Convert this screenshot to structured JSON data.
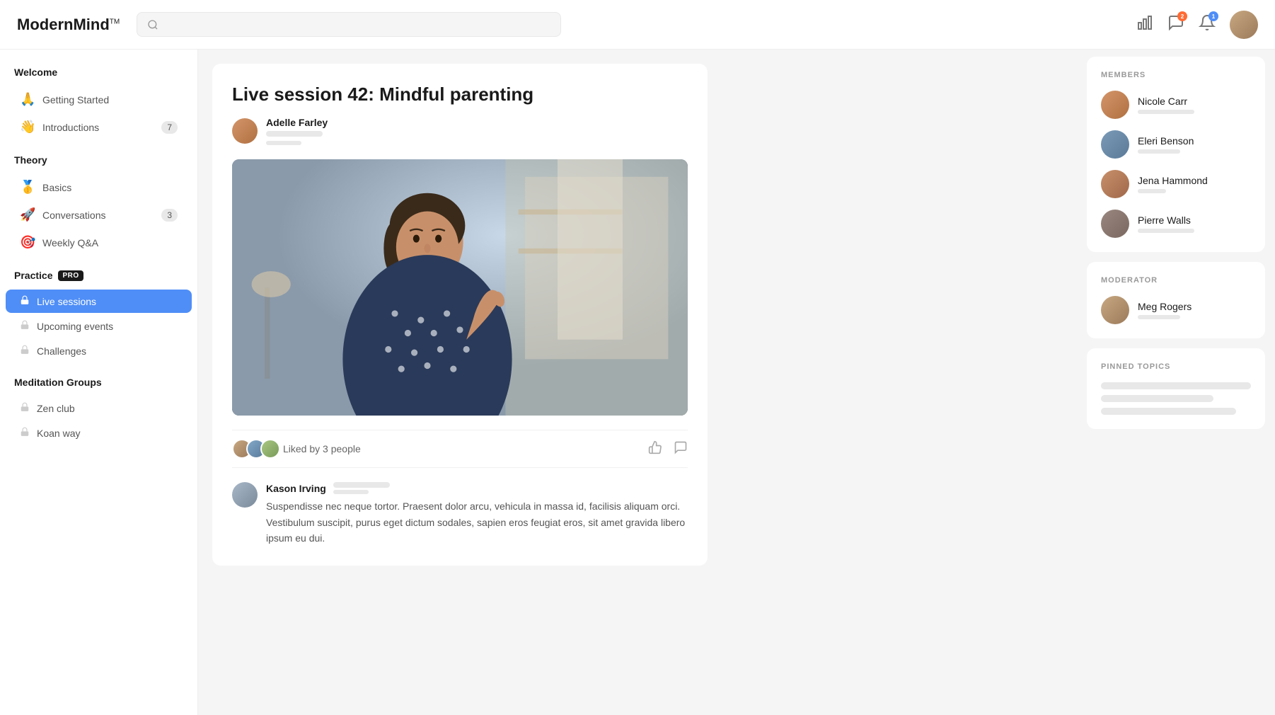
{
  "header": {
    "logo": "ModernMind",
    "logo_tm": "TM",
    "search_placeholder": ""
  },
  "sidebar": {
    "sections": [
      {
        "label": "Welcome",
        "items": [
          {
            "id": "getting-started",
            "icon": "🙏",
            "label": "Getting Started",
            "badge": null,
            "locked": false,
            "active": false
          },
          {
            "id": "introductions",
            "icon": "👋",
            "label": "Introductions",
            "badge": "7",
            "locked": false,
            "active": false
          }
        ]
      },
      {
        "label": "Theory",
        "items": [
          {
            "id": "basics",
            "icon": "🥇",
            "label": "Basics",
            "badge": null,
            "locked": false,
            "active": false
          },
          {
            "id": "conversations",
            "icon": "🚀",
            "label": "Conversations",
            "badge": "3",
            "locked": false,
            "active": false
          },
          {
            "id": "weekly-qa",
            "icon": "🎯",
            "label": "Weekly Q&A",
            "badge": null,
            "locked": false,
            "active": false
          }
        ]
      },
      {
        "label": "Practice",
        "pro": true,
        "items": [
          {
            "id": "live-sessions",
            "icon": "lock",
            "label": "Live sessions",
            "badge": null,
            "locked": true,
            "active": true
          },
          {
            "id": "upcoming-events",
            "icon": "lock",
            "label": "Upcoming events",
            "badge": null,
            "locked": true,
            "active": false
          },
          {
            "id": "challenges",
            "icon": "lock",
            "label": "Challenges",
            "badge": null,
            "locked": true,
            "active": false
          }
        ]
      },
      {
        "label": "Meditation Groups",
        "items": [
          {
            "id": "zen-club",
            "icon": "lock",
            "label": "Zen club",
            "badge": null,
            "locked": true,
            "active": false
          },
          {
            "id": "koan-way",
            "icon": "lock",
            "label": "Koan way",
            "badge": null,
            "locked": true,
            "active": false
          }
        ]
      }
    ]
  },
  "main": {
    "title": "Live session 42: Mindful parenting",
    "author": {
      "name": "Adelle Farley"
    },
    "liked_text": "Liked by 3 people",
    "comment": {
      "author": "Kason Irving",
      "text": "Suspendisse nec neque tortor. Praesent dolor arcu, vehicula in massa id, facilisis aliquam orci. Vestibulum suscipit, purus eget dictum sodales, sapien eros feugiat eros, sit amet gravida libero ipsum eu dui."
    }
  },
  "right_panel": {
    "members_label": "MEMBERS",
    "members": [
      {
        "name": "Nicole Carr",
        "id": "nicole"
      },
      {
        "name": "Eleri Benson",
        "id": "eleri"
      },
      {
        "name": "Jena Hammond",
        "id": "jena"
      },
      {
        "name": "Pierre Walls",
        "id": "pierre"
      }
    ],
    "moderator_label": "MODERATOR",
    "moderator": {
      "name": "Meg Rogers"
    },
    "pinned_label": "PINNED TOPICS"
  }
}
